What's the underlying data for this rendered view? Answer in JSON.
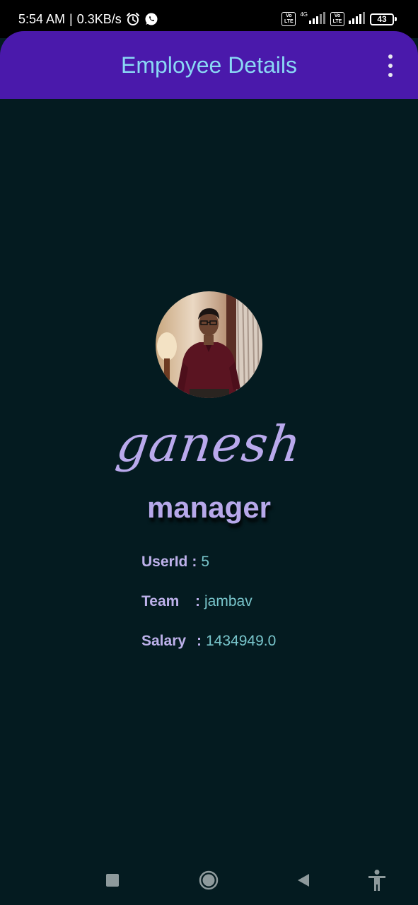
{
  "status_bar": {
    "time": "5:54 AM",
    "separator": "|",
    "speed": "0.3KB/s",
    "left_icons": [
      "alarm-icon",
      "whatsapp-icon"
    ],
    "volte_label": "Vo LTE",
    "network_type": "4G",
    "battery": "43"
  },
  "app_bar": {
    "title": "Employee Details",
    "menu_icon": "more-vert-icon",
    "background": "#4a19ab",
    "title_color": "#8ad8f4"
  },
  "profile": {
    "photo_alt": "employee photo",
    "name": "ganesh",
    "role": "manager"
  },
  "details": {
    "userid": {
      "label": "UserId",
      "separator": ":",
      "value": "5"
    },
    "team": {
      "label": "Team",
      "separator": ":",
      "value": "jambav"
    },
    "salary": {
      "label": "Salary",
      "separator": ":",
      "value": "1434949.0"
    }
  },
  "nav_bar": {
    "icons": [
      "recent-apps-icon",
      "home-icon",
      "back-icon",
      "accessibility-icon"
    ]
  },
  "colors": {
    "background": "#041b20",
    "label": "#bdb1ea",
    "value": "#79c6cc"
  }
}
